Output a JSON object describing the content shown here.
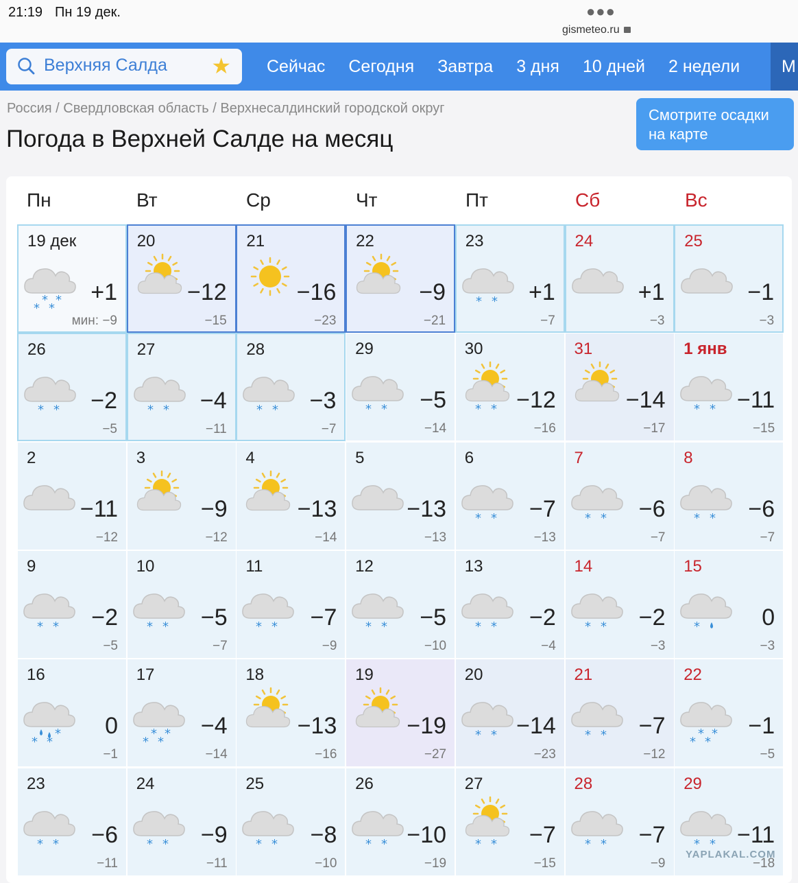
{
  "status_bar": {
    "time": "21:19",
    "date": "Пн 19 дек.",
    "url": "gismeteo.ru"
  },
  "search": {
    "city": "Верхняя Салда"
  },
  "nav": {
    "items": [
      "Сейчас",
      "Сегодня",
      "Завтра",
      "3 дня",
      "10 дней",
      "2 недели"
    ],
    "more": "М"
  },
  "breadcrumb": "Россия / Свердловская область / Верхнесалдинский городской округ",
  "title": "Погода в Верхней Салде на месяц",
  "map_button": {
    "line1": "Смотрите осадки",
    "line2": "на карте"
  },
  "weekdays": [
    "Пн",
    "Вт",
    "Ср",
    "Чт",
    "Пт",
    "Сб",
    "Вс"
  ],
  "min_prefix": "мин:",
  "watermark": "YAPLAKAL.COM",
  "colors": {
    "accent": "#3f8ae8",
    "weekend": "#c8242c",
    "today_border": "#4b7fd3",
    "cell": "#e9f3fa"
  },
  "days": [
    {
      "d": "19 дек",
      "max": "+1",
      "min": "−9",
      "icon": "cloud",
      "precip": "snow2"
    },
    {
      "d": "20",
      "max": "−12",
      "min": "−15",
      "icon": "sun-cloud",
      "precip": ""
    },
    {
      "d": "21",
      "max": "−16",
      "min": "−23",
      "icon": "sun",
      "precip": ""
    },
    {
      "d": "22",
      "max": "−9",
      "min": "−21",
      "icon": "sun-cloud",
      "precip": ""
    },
    {
      "d": "23",
      "max": "+1",
      "min": "−7",
      "icon": "cloud",
      "precip": "snow"
    },
    {
      "d": "24",
      "max": "+1",
      "min": "−3",
      "icon": "cloud",
      "precip": ""
    },
    {
      "d": "25",
      "max": "−1",
      "min": "−3",
      "icon": "cloud",
      "precip": ""
    },
    {
      "d": "26",
      "max": "−2",
      "min": "−5",
      "icon": "cloud",
      "precip": "snow"
    },
    {
      "d": "27",
      "max": "−4",
      "min": "−11",
      "icon": "cloud",
      "precip": "snow"
    },
    {
      "d": "28",
      "max": "−3",
      "min": "−7",
      "icon": "cloud",
      "precip": "snow"
    },
    {
      "d": "29",
      "max": "−5",
      "min": "−14",
      "icon": "cloud",
      "precip": "snow"
    },
    {
      "d": "30",
      "max": "−12",
      "min": "−16",
      "icon": "sun-cloud",
      "precip": "snow"
    },
    {
      "d": "31",
      "max": "−14",
      "min": "−17",
      "icon": "sun-cloud",
      "precip": ""
    },
    {
      "d": "1 янв",
      "max": "−11",
      "min": "−15",
      "icon": "cloud",
      "precip": "snow"
    },
    {
      "d": "2",
      "max": "−11",
      "min": "−12",
      "icon": "cloud",
      "precip": ""
    },
    {
      "d": "3",
      "max": "−9",
      "min": "−12",
      "icon": "sun-cloud",
      "precip": ""
    },
    {
      "d": "4",
      "max": "−13",
      "min": "−14",
      "icon": "sun-cloud",
      "precip": ""
    },
    {
      "d": "5",
      "max": "−13",
      "min": "−13",
      "icon": "cloud",
      "precip": ""
    },
    {
      "d": "6",
      "max": "−7",
      "min": "−13",
      "icon": "cloud",
      "precip": "snow"
    },
    {
      "d": "7",
      "max": "−6",
      "min": "−7",
      "icon": "cloud",
      "precip": "snow"
    },
    {
      "d": "8",
      "max": "−6",
      "min": "−7",
      "icon": "cloud",
      "precip": "snow"
    },
    {
      "d": "9",
      "max": "−2",
      "min": "−5",
      "icon": "cloud",
      "precip": "snow"
    },
    {
      "d": "10",
      "max": "−5",
      "min": "−7",
      "icon": "cloud",
      "precip": "snow"
    },
    {
      "d": "11",
      "max": "−7",
      "min": "−9",
      "icon": "cloud",
      "precip": "snow"
    },
    {
      "d": "12",
      "max": "−5",
      "min": "−10",
      "icon": "cloud",
      "precip": "snow"
    },
    {
      "d": "13",
      "max": "−2",
      "min": "−4",
      "icon": "cloud",
      "precip": "snow"
    },
    {
      "d": "14",
      "max": "−2",
      "min": "−3",
      "icon": "cloud",
      "precip": "snow"
    },
    {
      "d": "15",
      "max": "0",
      "min": "−3",
      "icon": "cloud",
      "precip": "sleet"
    },
    {
      "d": "16",
      "max": "0",
      "min": "−1",
      "icon": "cloud",
      "precip": "sleet2"
    },
    {
      "d": "17",
      "max": "−4",
      "min": "−14",
      "icon": "cloud",
      "precip": "snow2"
    },
    {
      "d": "18",
      "max": "−13",
      "min": "−16",
      "icon": "sun-cloud",
      "precip": ""
    },
    {
      "d": "19",
      "max": "−19",
      "min": "−27",
      "icon": "sun-cloud",
      "precip": ""
    },
    {
      "d": "20",
      "max": "−14",
      "min": "−23",
      "icon": "cloud",
      "precip": "snow"
    },
    {
      "d": "21",
      "max": "−7",
      "min": "−12",
      "icon": "cloud",
      "precip": "snow"
    },
    {
      "d": "22",
      "max": "−1",
      "min": "−5",
      "icon": "cloud",
      "precip": "snow2"
    },
    {
      "d": "23",
      "max": "−6",
      "min": "−11",
      "icon": "cloud",
      "precip": "snow"
    },
    {
      "d": "24",
      "max": "−9",
      "min": "−11",
      "icon": "cloud",
      "precip": "snow"
    },
    {
      "d": "25",
      "max": "−8",
      "min": "−10",
      "icon": "cloud",
      "precip": "snow"
    },
    {
      "d": "26",
      "max": "−10",
      "min": "−19",
      "icon": "cloud",
      "precip": "snow"
    },
    {
      "d": "27",
      "max": "−7",
      "min": "−15",
      "icon": "sun-cloud",
      "precip": "snow"
    },
    {
      "d": "28",
      "max": "−7",
      "min": "−9",
      "icon": "cloud",
      "precip": "snow"
    },
    {
      "d": "29",
      "max": "−11",
      "min": "−18",
      "icon": "cloud",
      "precip": "snow"
    }
  ]
}
